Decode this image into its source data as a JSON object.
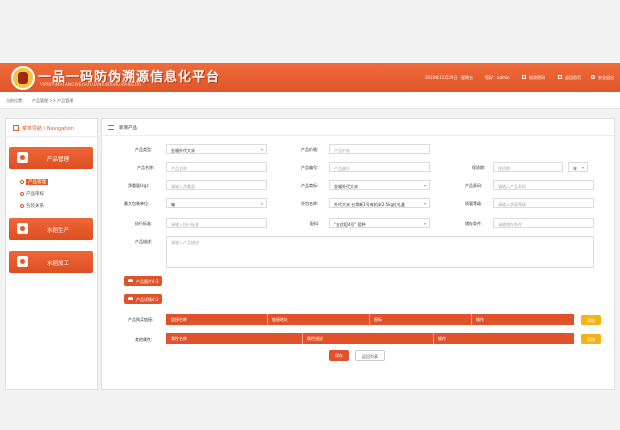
{
  "header": {
    "title": "一品一码防伪溯源信息化平台",
    "subtitle": "YIPINYIMAFANGWEISUYUANXINXIHUAPINGTAI",
    "date": "2019年11月29日 · 星期五",
    "user_label": "您好：admin",
    "actions": [
      {
        "label": "修改密码",
        "icon": "key-icon"
      },
      {
        "label": "返回首页",
        "icon": "home-icon"
      },
      {
        "label": "安全退出",
        "icon": "power-icon"
      }
    ]
  },
  "breadcrumb": {
    "prefix": "当前位置：",
    "path": "产品管理 >> 产品管理"
  },
  "sidebar": {
    "title": "菜单导航 / Navigation",
    "groups": [
      {
        "label": "产品管理",
        "icon": "product-icon"
      },
      {
        "label": "水稻生产",
        "icon": "plant-icon"
      },
      {
        "label": "水稻加工",
        "icon": "factory-icon"
      }
    ],
    "sub_items": [
      "产品管理",
      "产品审核",
      "包装关系"
    ]
  },
  "form": {
    "section_title": "新增产品",
    "fields": {
      "category": {
        "label": "产品类型:",
        "value": "金福外代大米"
      },
      "price": {
        "label": "产品价格:",
        "placeholder": "产品价格"
      },
      "name": {
        "label": "产品名称:",
        "placeholder": "产品名称"
      },
      "code": {
        "label": "产品编号:",
        "placeholder": "产品编号"
      },
      "shelf_life": {
        "label": "保质期:",
        "placeholder": "保质期",
        "unit": "年"
      },
      "weight": {
        "label": "净重量(kg):",
        "placeholder": "请输入净重量"
      },
      "brand": {
        "label": "产品商标:",
        "value": "金福外代大米"
      },
      "barcode": {
        "label": "产品条码:",
        "placeholder": "请输入产品条码"
      },
      "max_pack": {
        "label": "最大包装单位:",
        "value": "箱"
      },
      "package_name": {
        "label": "外包名称:",
        "value": "外代大米·五常新1号有机米2.5kg红礼盒"
      },
      "quality_level": {
        "label": "质量等级:",
        "placeholder": "请输入质量等级"
      },
      "standard": {
        "label": "执行标准:",
        "placeholder": "请输入执行标准"
      },
      "ingredients": {
        "label": "配料:",
        "value": "\"五优稻4号\" 稻种"
      },
      "storage": {
        "label": "储存条件:",
        "placeholder": "请输储存条件"
      },
      "description": {
        "label": "产品描述:",
        "placeholder": "请输入产品描述"
      }
    },
    "upload_buttons": [
      "产品图片4:3",
      "产品详情4:3"
    ],
    "purchase": {
      "label": "产品购买链接:",
      "columns": [
        "链接名称",
        "链接地址",
        "图标",
        "操作"
      ],
      "add_label": "添加"
    },
    "other_attrs": {
      "label": "其他属性:",
      "columns": [
        "属性名称",
        "属性描述",
        "操作"
      ],
      "add_label": "添加"
    },
    "save_label": "保存",
    "back_label": "返回列表"
  }
}
